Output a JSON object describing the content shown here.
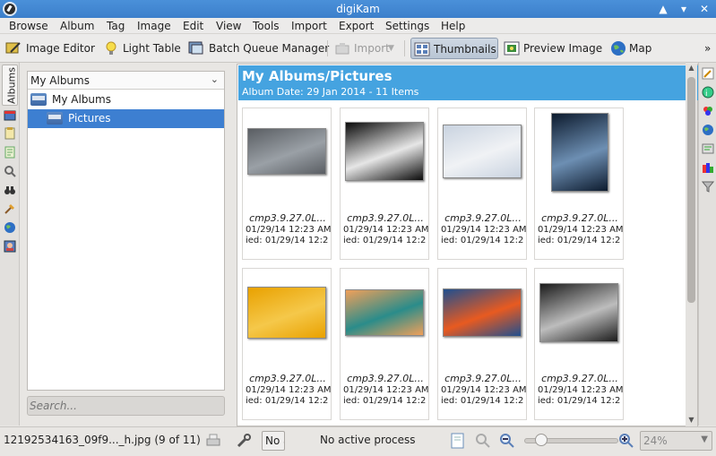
{
  "window": {
    "title": "digiKam"
  },
  "menu": [
    "Browse",
    "Album",
    "Tag",
    "Image",
    "Edit",
    "View",
    "Tools",
    "Import",
    "Export",
    "Settings",
    "Help"
  ],
  "toolbar": {
    "image_editor": "Image Editor",
    "light_table": "Light Table",
    "batch_queue": "Batch Queue Manager",
    "import": "Import",
    "thumbnails": "Thumbnails",
    "preview": "Preview Image",
    "map": "Map",
    "overflow": "»"
  },
  "left_tabs": {
    "albums": "Albums"
  },
  "album_panel": {
    "combo_value": "My Albums",
    "tree": [
      {
        "label": "My Albums"
      },
      {
        "label": "Pictures",
        "selected": true
      }
    ],
    "search_placeholder": "Search..."
  },
  "header": {
    "title": "My Albums/Pictures",
    "subtitle": "Album Date: 29 Jan 2014 - 11 Items"
  },
  "thumbnails": [
    {
      "name": "cmp3.9.27.0L...",
      "date": "01/29/14 12:23 AM",
      "modified": "ied: 01/29/14 12:2",
      "colors": [
        "#5a5e63",
        "#9aa0a6"
      ]
    },
    {
      "name": "cmp3.9.27.0L...",
      "date": "01/29/14 12:23 AM",
      "modified": "ied: 01/29/14 12:2",
      "colors": [
        "#0a0a0a",
        "#e6e6e6"
      ]
    },
    {
      "name": "cmp3.9.27.0L...",
      "date": "01/29/14 12:23 AM",
      "modified": "ied: 01/29/14 12:2",
      "colors": [
        "#c9d3e0",
        "#f0f2f5"
      ]
    },
    {
      "name": "cmp3.9.27.0L...",
      "date": "01/29/14 12:23 AM",
      "modified": "ied: 01/29/14 12:2",
      "colors": [
        "#0d1b2e",
        "#6d8fb3"
      ]
    },
    {
      "name": "cmp3.9.27.0L...",
      "date": "01/29/14 12:23 AM",
      "modified": "ied: 01/29/14 12:2",
      "colors": [
        "#e9a100",
        "#f5c84a"
      ]
    },
    {
      "name": "cmp3.9.27.0L...",
      "date": "01/29/14 12:23 AM",
      "modified": "ied: 01/29/14 12:2",
      "colors": [
        "#f0a05a",
        "#2a8c8a"
      ]
    },
    {
      "name": "cmp3.9.27.0L...",
      "date": "01/29/14 12:23 AM",
      "modified": "ied: 01/29/14 12:2",
      "colors": [
        "#1f4f8f",
        "#e85a20"
      ]
    },
    {
      "name": "cmp3.9.27.0L...",
      "date": "01/29/14 12:23 AM",
      "modified": "ied: 01/29/14 12:2",
      "colors": [
        "#1c1c1c",
        "#bdbdbd"
      ]
    }
  ],
  "status": {
    "file": "12192534163_09f9..._h.jpg (9 of 11)",
    "box": "No a",
    "process": "No active process",
    "zoom": "24%",
    "zoom_slider": 0.12
  },
  "colors": {
    "titlebar": "#3c7fcb",
    "header": "#45a3e0",
    "selection": "#3d7fd1"
  }
}
